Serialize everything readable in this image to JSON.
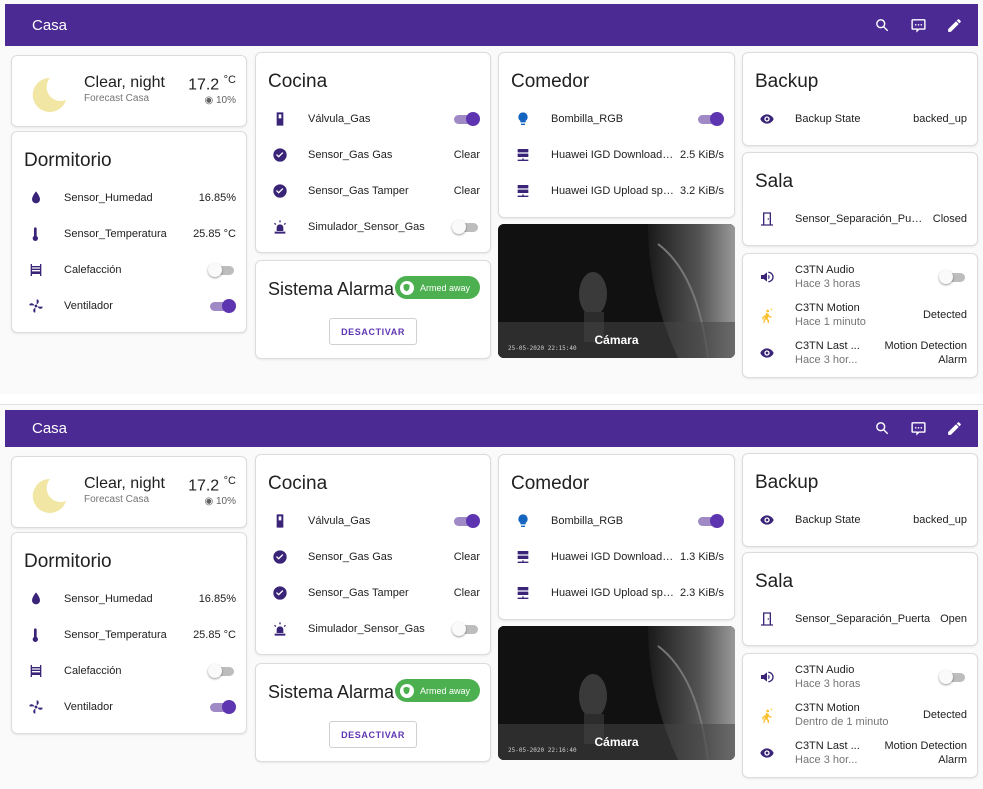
{
  "shots": [
    {
      "topbar": {
        "title": "Casa"
      },
      "weather": {
        "condition": "Clear, night",
        "forecast": "Forecast Casa",
        "temp": "17.2",
        "temp_unit": "°C",
        "humidity": "10%"
      },
      "dormitorio": {
        "title": "Dormitorio",
        "rows": [
          {
            "label": "Sensor_Humedad",
            "value": "16.85%"
          },
          {
            "label": "Sensor_Temperatura",
            "value": "25.85 °C"
          },
          {
            "label": "Calefacción",
            "toggle": "off"
          },
          {
            "label": "Ventilador",
            "toggle": "on"
          }
        ]
      },
      "cocina": {
        "title": "Cocina",
        "rows": [
          {
            "label": "Válvula_Gas",
            "toggle": "on"
          },
          {
            "label": "Sensor_Gas Gas",
            "value": "Clear"
          },
          {
            "label": "Sensor_Gas Tamper",
            "value": "Clear"
          },
          {
            "label": "Simulador_Sensor_Gas",
            "toggle": "off"
          }
        ]
      },
      "alarma": {
        "title": "Sistema Alarma",
        "state": "Armed away",
        "button": "DESACTIVAR"
      },
      "comedor": {
        "title": "Comedor",
        "rows": [
          {
            "label": "Bombilla_RGB",
            "toggle": "on"
          },
          {
            "label": "Huawei IGD Download s...",
            "value": "2.5 KiB/s"
          },
          {
            "label": "Huawei IGD Upload speed",
            "value": "3.2 KiB/s"
          }
        ]
      },
      "camera": {
        "caption": "Cámara",
        "timestamp": "25-05-2020 22:15:40"
      },
      "backup": {
        "title": "Backup",
        "label": "Backup State",
        "value": "backed_up"
      },
      "sala": {
        "title": "Sala",
        "label": "Sensor_Separación_Puerta",
        "value": "Closed"
      },
      "c3tn": {
        "audio": {
          "name": "C3TN Audio",
          "sec": "Hace 3 horas",
          "toggle": "off"
        },
        "motion": {
          "name": "C3TN Motion",
          "sec": "Hace 1 minuto",
          "value": "Detected"
        },
        "last": {
          "name": "C3TN Last ...",
          "sec": "Hace 3 hor...",
          "value1": "Motion Detection",
          "value2": "Alarm"
        }
      }
    },
    {
      "topbar": {
        "title": "Casa"
      },
      "weather": {
        "condition": "Clear, night",
        "forecast": "Forecast Casa",
        "temp": "17.2",
        "temp_unit": "°C",
        "humidity": "10%"
      },
      "dormitorio": {
        "title": "Dormitorio",
        "rows": [
          {
            "label": "Sensor_Humedad",
            "value": "16.85%"
          },
          {
            "label": "Sensor_Temperatura",
            "value": "25.85 °C"
          },
          {
            "label": "Calefacción",
            "toggle": "off"
          },
          {
            "label": "Ventilador",
            "toggle": "on"
          }
        ]
      },
      "cocina": {
        "title": "Cocina",
        "rows": [
          {
            "label": "Válvula_Gas",
            "toggle": "on"
          },
          {
            "label": "Sensor_Gas Gas",
            "value": "Clear"
          },
          {
            "label": "Sensor_Gas Tamper",
            "value": "Clear"
          },
          {
            "label": "Simulador_Sensor_Gas",
            "toggle": "off"
          }
        ]
      },
      "alarma": {
        "title": "Sistema Alarma",
        "state": "Armed away",
        "button": "DESACTIVAR"
      },
      "comedor": {
        "title": "Comedor",
        "rows": [
          {
            "label": "Bombilla_RGB",
            "toggle": "on"
          },
          {
            "label": "Huawei IGD Download s...",
            "value": "1.3 KiB/s"
          },
          {
            "label": "Huawei IGD Upload speed",
            "value": "2.3 KiB/s"
          }
        ]
      },
      "camera": {
        "caption": "Cámara",
        "timestamp": "25-05-2020 22:16:40"
      },
      "backup": {
        "title": "Backup",
        "label": "Backup State",
        "value": "backed_up"
      },
      "sala": {
        "title": "Sala",
        "label": "Sensor_Separación_Puerta",
        "value": "Open"
      },
      "c3tn": {
        "audio": {
          "name": "C3TN Audio",
          "sec": "Hace 3 horas",
          "toggle": "off"
        },
        "motion": {
          "name": "C3TN Motion",
          "sec": "Dentro de 1 minuto",
          "value": "Detected"
        },
        "last": {
          "name": "C3TN Last ...",
          "sec": "Hace 3 hor...",
          "value1": "Motion Detection",
          "value2": "Alarm"
        }
      }
    }
  ],
  "icons": {
    "search": "search-icon",
    "chat": "chat-icon",
    "edit": "pencil-icon",
    "moon": "moon-icon",
    "drop": "water-drop-icon",
    "thermo": "thermometer-icon",
    "radiator": "radiator-icon",
    "fan": "fan-icon",
    "valve": "gas-valve-icon",
    "check": "check-circle-icon",
    "siren": "siren-icon",
    "shield": "shield-icon",
    "bulb": "lightbulb-icon",
    "server": "server-network-icon",
    "eye": "eye-icon",
    "door": "door-icon",
    "speaker": "speaker-icon",
    "walk": "motion-sensor-icon"
  },
  "colors": {
    "header": "#4b2a93",
    "accent": "#5e35b1",
    "armed_badge": "#4caf50",
    "icon": "#3a2477"
  }
}
